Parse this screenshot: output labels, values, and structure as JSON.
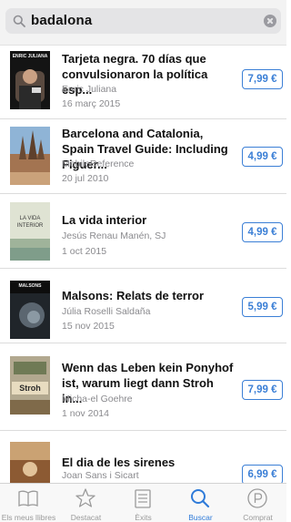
{
  "search": {
    "query": "badalona"
  },
  "books": [
    {
      "title": "Tarjeta negra. 70 días que convulsionaron la política esp...",
      "author": "Enric Juliana",
      "date": "16 març 2015",
      "price": "7,99 €",
      "cover_bg": "#1a1a1a",
      "cover_text": "ENRIC JULIANA"
    },
    {
      "title": "Barcelona and Catalonia, Spain Travel Guide: Including Figuer...",
      "author": "MobileReference",
      "date": "20 jul 2010",
      "price": "4,99 €",
      "cover_bg": "#c7a070",
      "cover_text": ""
    },
    {
      "title": "La vida interior",
      "author": "Jesús Renau Manén, SJ",
      "date": "1 oct 2015",
      "price": "4,99 €",
      "cover_bg": "#d9dfcf",
      "cover_text": "LA VIDA INTERIOR"
    },
    {
      "title": "Malsons: Relats de terror",
      "author": "Júlia Roselli Saldaña",
      "date": "15 nov 2015",
      "price": "5,99 €",
      "cover_bg": "#2a2e33",
      "cover_text": "MALSONS"
    },
    {
      "title": "Wenn das Leben kein Ponyhof ist, warum liegt dann Stroh in...",
      "author": "Micha-el Goehre",
      "date": "1 nov 2014",
      "price": "7,99 €",
      "cover_bg": "#a8a08a",
      "cover_text": "Stroh"
    },
    {
      "title": "El dia de les sirenes",
      "author": "Joan Sans i Sicart",
      "date": "",
      "price": "6,99 €",
      "cover_bg": "#b67a4a",
      "cover_text": ""
    }
  ],
  "tabs": [
    {
      "label": "Els meus llibres",
      "icon": "book-icon"
    },
    {
      "label": "Destacat",
      "icon": "star-icon"
    },
    {
      "label": "Èxits",
      "icon": "list-icon"
    },
    {
      "label": "Buscar",
      "icon": "search-icon",
      "active": true
    },
    {
      "label": "Comprat",
      "icon": "purchased-icon"
    }
  ],
  "colors": {
    "accent": "#3b7fd6",
    "tab_active": "#2f7bd9",
    "secondary_text": "#8a8a8e"
  }
}
